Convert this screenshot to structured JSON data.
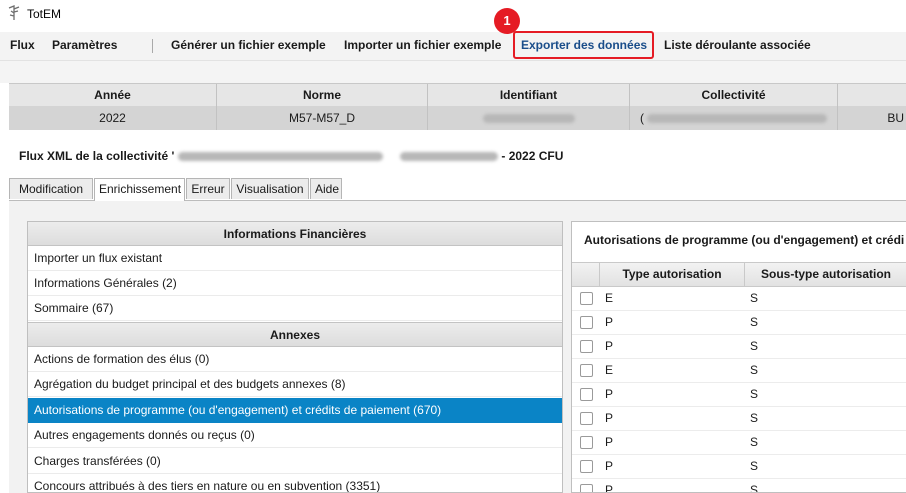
{
  "window": {
    "title": "TotEM"
  },
  "menu": {
    "items": [
      {
        "label": "Flux"
      },
      {
        "label": "Paramètres"
      },
      {
        "label": "Générer un fichier exemple"
      },
      {
        "label": "Importer un fichier exemple"
      },
      {
        "label": "Exporter des données"
      },
      {
        "label": "Liste déroulante associée"
      }
    ]
  },
  "annotation": {
    "step": "1",
    "color": "#e51b24"
  },
  "info_table": {
    "headers": [
      "Année",
      "Norme",
      "Identifiant",
      "Collectivité"
    ],
    "row": {
      "annee": "2022",
      "norme": "M57-M57_D",
      "collectivite_prefix": "(",
      "extra": "BU"
    }
  },
  "flux": {
    "prefix": "Flux XML de la collectivité '",
    "suffix": "- 2022 CFU"
  },
  "tabs": [
    {
      "label": "Modification",
      "active": false
    },
    {
      "label": "Enrichissement",
      "active": true
    },
    {
      "label": "Erreur",
      "active": false
    },
    {
      "label": "Visualisation",
      "active": false
    },
    {
      "label": "Aide",
      "active": false
    }
  ],
  "left_panel": {
    "section1": "Informations Financières",
    "items1": [
      "Importer un flux existant",
      "Informations Générales (2)",
      "Sommaire (67)"
    ],
    "section2": "Annexes",
    "items2": [
      "Actions de formation des élus (0)",
      "Agrégation du budget principal et des budgets annexes (8)",
      "Autorisations de programme (ou d'engagement) et crédits de paiement (670)",
      "Autres engagements donnés ou reçus (0)",
      "Charges transférées (0)",
      "Concours attribués à des tiers en nature ou en subvention (3351)"
    ],
    "selected_index": 2,
    "selected_color": "#0a84c6"
  },
  "right_panel": {
    "title": "Autorisations de programme (ou d'engagement) et crédi",
    "columns": [
      "Type autorisation",
      "Sous-type autorisation"
    ],
    "rows": [
      {
        "type": "E",
        "subtype": "S"
      },
      {
        "type": "P",
        "subtype": "S"
      },
      {
        "type": "P",
        "subtype": "S"
      },
      {
        "type": "E",
        "subtype": "S"
      },
      {
        "type": "P",
        "subtype": "S"
      },
      {
        "type": "P",
        "subtype": "S"
      },
      {
        "type": "P",
        "subtype": "S"
      },
      {
        "type": "P",
        "subtype": "S"
      },
      {
        "type": "P",
        "subtype": "S"
      }
    ]
  }
}
